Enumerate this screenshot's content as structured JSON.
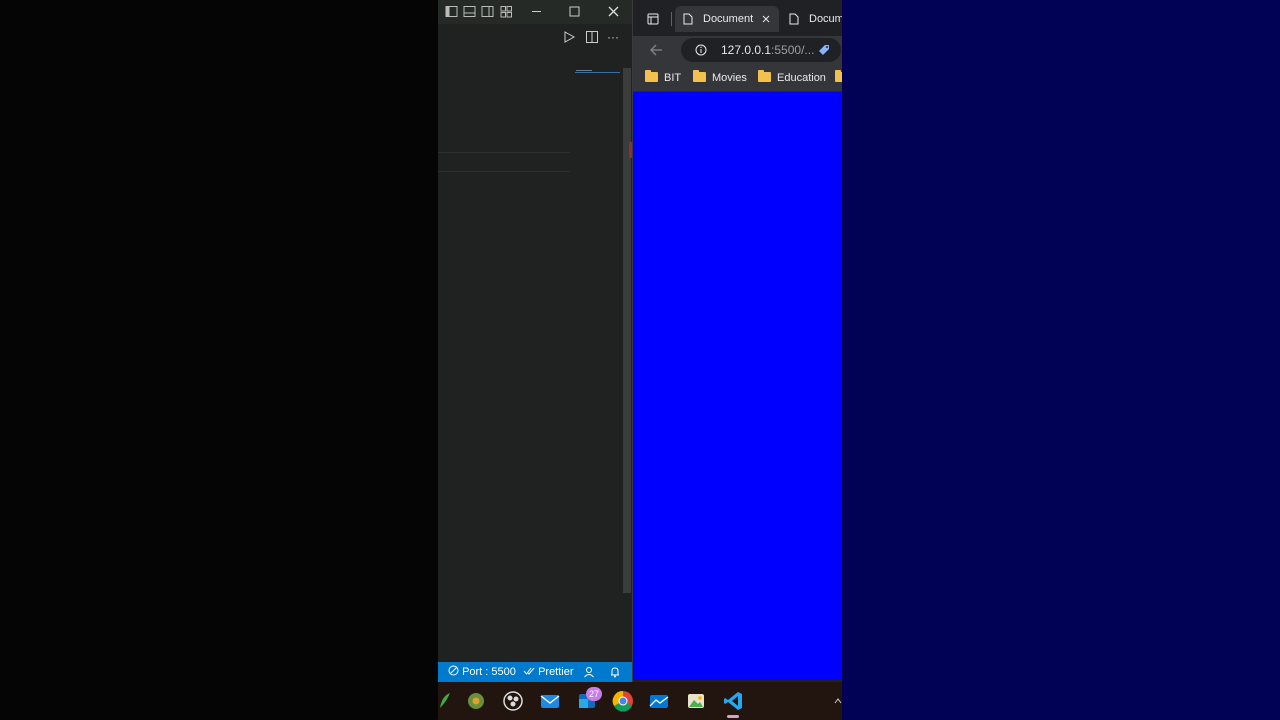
{
  "vscode": {
    "statusbar": {
      "port": "Port : 5500",
      "prettier": "Prettier"
    },
    "toolbar": {
      "more": "···"
    }
  },
  "browser": {
    "tabs": [
      {
        "title": "Document"
      },
      {
        "title": "Docume"
      }
    ],
    "address": {
      "host": "127.0.0.1",
      "path": ":5500/..."
    },
    "bookmarks": [
      {
        "label": "BIT"
      },
      {
        "label": "Movies"
      },
      {
        "label": "Education"
      }
    ],
    "page_background": "#0000ff"
  },
  "taskbar": {
    "mail_badge": "27",
    "icons": [
      "leaf-icon",
      "obs-alt-icon",
      "obs-icon",
      "mail-icon",
      "outlook-icon",
      "chrome-icon",
      "mail-2-icon",
      "image-icon",
      "vscode-icon",
      "chevron-up-icon"
    ]
  },
  "colors": {
    "vscode_bg": "#1f2220",
    "statusbar_bg": "#007acc",
    "desktop_right": "#010155",
    "taskbar_bg": "#22150f"
  }
}
